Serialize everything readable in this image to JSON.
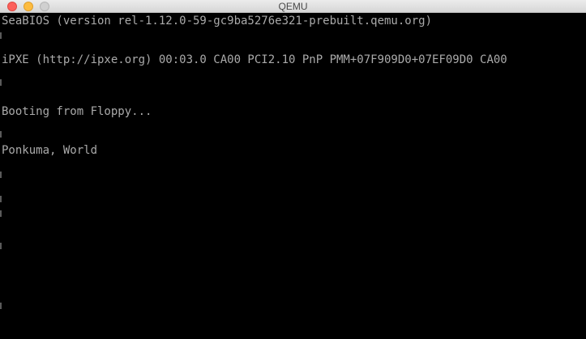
{
  "window": {
    "title": "QEMU"
  },
  "console": {
    "lines": [
      "SeaBIOS (version rel-1.12.0-59-gc9ba5276e321-prebuilt.qemu.org)",
      "iPXE (http://ipxe.org) 00:03.0 CA00 PCI2.10 PnP PMM+07F909D0+07EF09D0 CA00",
      "Booting from Floppy...",
      "Ponkuma, World"
    ]
  },
  "colors": {
    "console_background": "#000000",
    "console_text": "#aaaaaa",
    "titlebar": "#e6e6e6",
    "close_button": "#fc605b",
    "minimize_button": "#fdbc40",
    "zoom_button": "#d0d0d0"
  }
}
